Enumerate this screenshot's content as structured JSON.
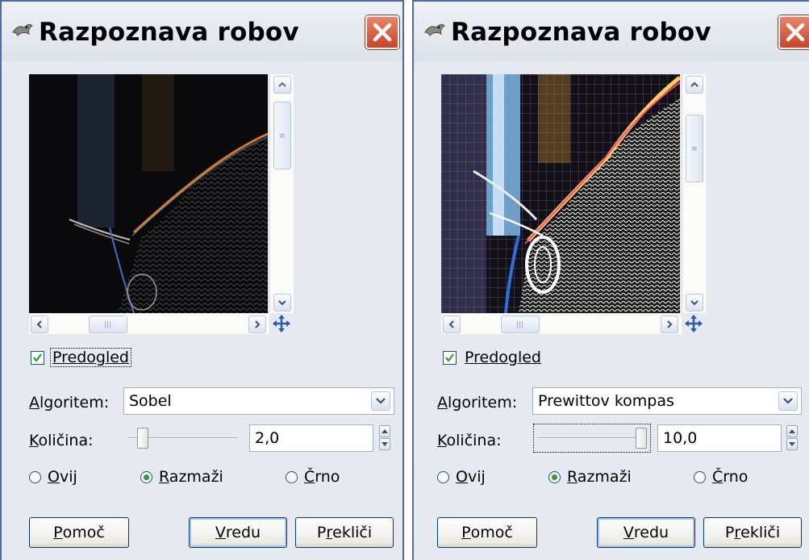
{
  "dialogs": [
    {
      "title": "Razpoznava robov",
      "preview": {
        "label": "Predogled",
        "checked": true
      },
      "algorithm": {
        "label_u": "A",
        "label_rest": "lgoritem:",
        "value": "Sobel"
      },
      "amount": {
        "label_u": "K",
        "label_rest": "oličina:",
        "value": "2,0",
        "slider_fraction": 0.1
      },
      "radios": [
        {
          "u": "O",
          "rest": "vij",
          "checked": false
        },
        {
          "u": "R",
          "rest": "azmaži",
          "checked": true
        },
        {
          "u": "Č",
          "rest": "rno",
          "checked": false
        }
      ],
      "buttons": {
        "help": {
          "u": "P",
          "rest": "omoč"
        },
        "ok": {
          "u": "V",
          "rest": " redu"
        },
        "cancel": {
          "pre": "P",
          "u": "r",
          "rest": "ekliči"
        }
      }
    },
    {
      "title": "Razpoznava robov",
      "preview": {
        "label": "Predogled",
        "checked": true
      },
      "algorithm": {
        "label_u": "A",
        "label_rest": "lgoritem:",
        "value": "Prewittov kompas"
      },
      "amount": {
        "label_u": "K",
        "label_rest": "oličina:",
        "value": "10,0",
        "slider_fraction": 1.0
      },
      "radios": [
        {
          "u": "O",
          "rest": "vij",
          "checked": false
        },
        {
          "u": "R",
          "rest": "azmaži",
          "checked": true
        },
        {
          "u": "Č",
          "rest": "rno",
          "checked": false
        }
      ],
      "buttons": {
        "help": {
          "u": "P",
          "rest": "omoč"
        },
        "ok": {
          "u": "V",
          "rest": " redu"
        },
        "cancel": {
          "pre": "P",
          "u": "r",
          "rest": "ekliči"
        }
      }
    }
  ],
  "colors": {
    "titlebar": "#e6e9ef",
    "border": "#4d6ba8",
    "close": "#d2553b",
    "radio_dot": "#2a9f29"
  },
  "icons": [
    "gimp-wilber-icon",
    "close-icon",
    "scroll-up-icon",
    "scroll-down-icon",
    "scroll-left-icon",
    "scroll-right-icon",
    "navigate-icon",
    "chevron-down-icon",
    "checkmark-icon"
  ]
}
